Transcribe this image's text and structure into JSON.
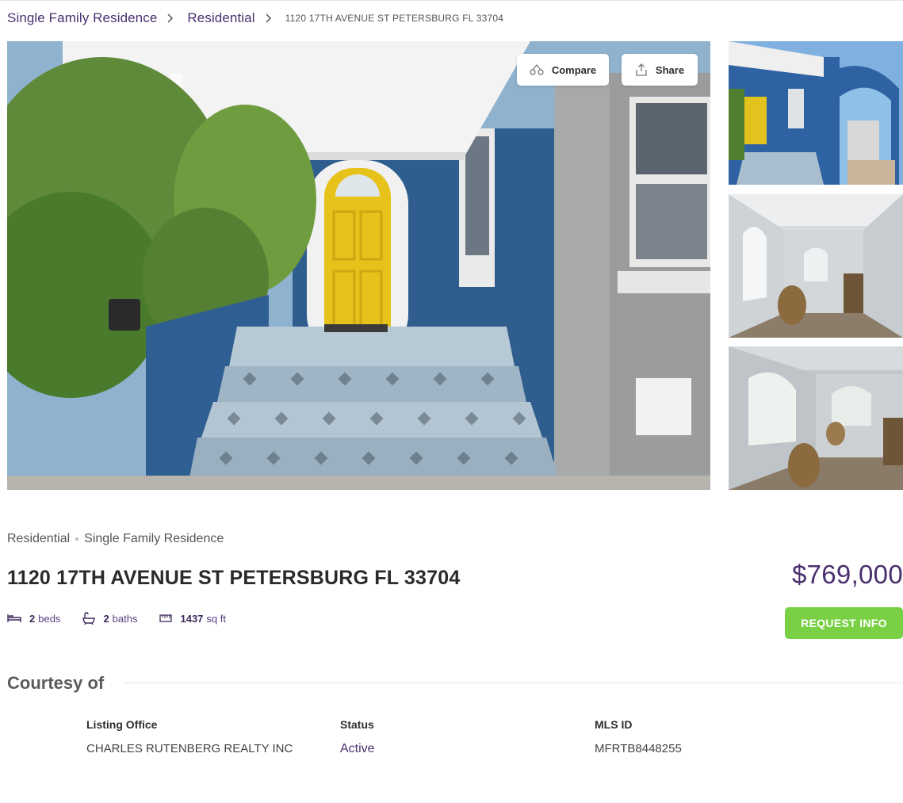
{
  "breadcrumb": {
    "items": [
      "Single Family Residence",
      "Residential"
    ],
    "current": "1120 17TH AVENUE ST PETERSBURG FL 33704"
  },
  "gallery": {
    "compare_label": "Compare",
    "share_label": "Share"
  },
  "listing": {
    "property_type": "Residential",
    "property_subtype": "Single Family Residence",
    "address": "1120 17TH AVENUE ST PETERSBURG FL 33704",
    "price": "$769,000",
    "beds": "2",
    "beds_unit": "beds",
    "baths": "2",
    "baths_unit": "baths",
    "sqft": "1437",
    "sqft_unit": "sq ft",
    "request_label": "REQUEST INFO"
  },
  "courtesy": {
    "heading": "Courtesy of",
    "office_label": "Listing Office",
    "office_value": "CHARLES RUTENBERG REALTY INC",
    "status_label": "Status",
    "status_value": "Active",
    "mls_label": "MLS ID",
    "mls_value": "MFRTB8448255"
  },
  "colors": {
    "brand_purple": "#4a2f6e",
    "request_green": "#7ad045",
    "wall_blue": "#2e5d8e",
    "door_yellow": "#e6c21a"
  },
  "icons": [
    "chevron-right-icon",
    "compare-icon",
    "share-icon",
    "bed-icon",
    "bath-icon",
    "ruler-icon"
  ]
}
